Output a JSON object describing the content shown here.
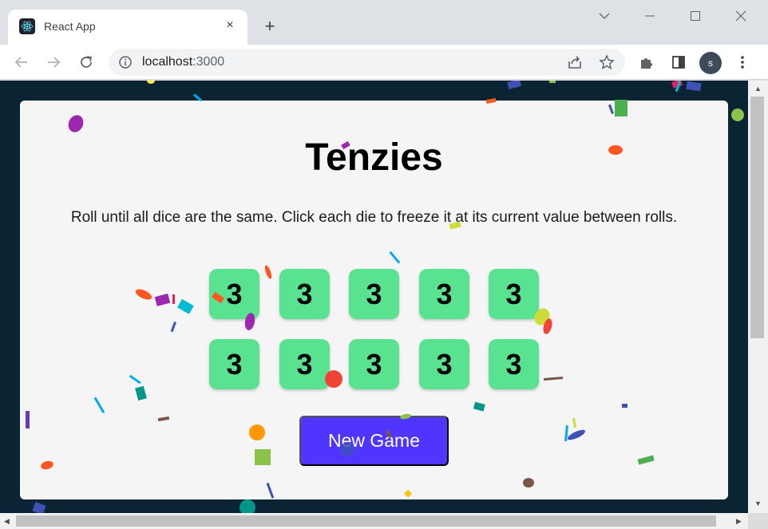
{
  "browser": {
    "tab_title": "React App",
    "tab_close": "×",
    "new_tab": "+",
    "url_host": "localhost",
    "url_port": ":3000",
    "profile_initial": "s"
  },
  "game": {
    "title": "Tenzies",
    "instructions": "Roll until all dice are the same. Click each die to freeze it at its current value between rolls.",
    "dice": [
      3,
      3,
      3,
      3,
      3,
      3,
      3,
      3,
      3,
      3
    ],
    "held_color": "#59e391",
    "button_label": "New Game",
    "button_color": "#5035ff"
  },
  "icons": {
    "back": "arrow-left-icon",
    "forward": "arrow-right-icon",
    "reload": "reload-icon",
    "site_info": "info-icon",
    "share": "share-icon",
    "bookmark": "star-icon",
    "extensions": "puzzle-icon",
    "sidepanel": "sidepanel-icon",
    "menu": "kebab-menu-icon"
  }
}
